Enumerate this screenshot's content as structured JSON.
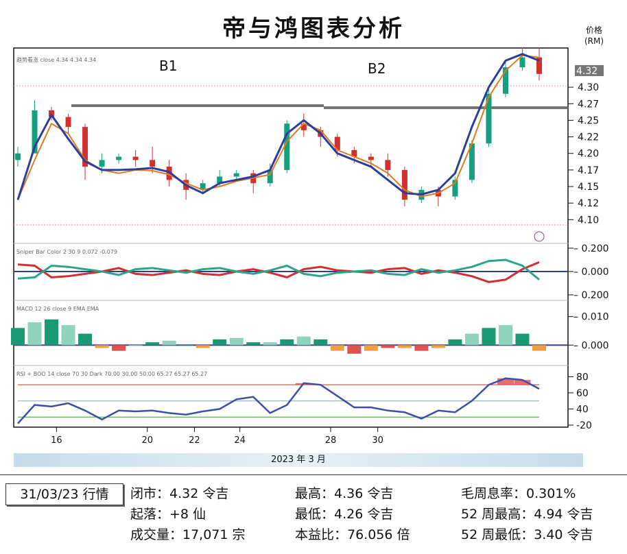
{
  "title": "帝与鸿图表分析",
  "price_unit": [
    "价格",
    "(RM)"
  ],
  "period_label": "2023 年 3 月",
  "colors": {
    "up": "#14a07e",
    "down": "#d22f2f",
    "ma_fast": "#2c3e9c",
    "ma_slow": "#e07b20",
    "resistance": "#707070"
  },
  "stats": {
    "date_label": "31/03/23 行情",
    "close": "闭市：4.32 令吉",
    "change": "起落：+8 仙",
    "volume": "成交量：17,071 宗",
    "high": "最高：4.36 令吉",
    "low": "最低：4.26 令吉",
    "pe": "本益比：76.056 倍",
    "dividend": "毛周息率：0.301%",
    "w52_high": "52 周最高：4.94 令吉",
    "w52_low": "52 周最低：3.40 令吉"
  },
  "chart_data": {
    "type": "line",
    "annotations": [
      "B1",
      "B2"
    ],
    "x_ticks": [
      "16",
      "20",
      "22",
      "24",
      "28",
      "30"
    ],
    "price_panel": {
      "legend": "趋势看涨 close 4.34 4.34 4.34",
      "y_ticks": [
        "4.30",
        "4.27",
        "4.25",
        "4.22",
        "4.20",
        "4.17",
        "4.15",
        "4.12",
        "4.10"
      ],
      "last_price": "4.32",
      "resistance_level": 4.27,
      "ylim": [
        4.09,
        4.355
      ],
      "ma_fast": [
        4.13,
        4.21,
        4.258,
        4.222,
        4.188,
        4.175,
        4.175,
        4.176,
        4.178,
        4.172,
        4.152,
        4.14,
        4.155,
        4.16,
        4.165,
        4.175,
        4.23,
        4.25,
        4.23,
        4.2,
        4.19,
        4.18,
        4.16,
        4.14,
        4.138,
        4.145,
        4.17,
        4.24,
        4.3,
        4.34,
        4.35,
        4.34
      ],
      "ma_slow": [
        4.13,
        4.19,
        4.245,
        4.23,
        4.19,
        4.175,
        4.17,
        4.175,
        4.174,
        4.168,
        4.155,
        4.145,
        4.15,
        4.158,
        4.163,
        4.168,
        4.218,
        4.245,
        4.235,
        4.205,
        4.195,
        4.185,
        4.17,
        4.145,
        4.135,
        4.14,
        4.155,
        4.215,
        4.285,
        4.325,
        4.348,
        4.345
      ],
      "candles": [
        [
          4.19,
          4.2,
          4.21,
          4.18
        ],
        [
          4.2,
          4.265,
          4.28,
          4.2
        ],
        [
          4.265,
          4.255,
          4.27,
          4.25
        ],
        [
          4.255,
          4.24,
          4.26,
          4.23
        ],
        [
          4.24,
          4.18,
          4.245,
          4.16
        ],
        [
          4.18,
          4.19,
          4.2,
          4.17
        ],
        [
          4.19,
          4.195,
          4.2,
          4.185
        ],
        [
          4.195,
          4.19,
          4.205,
          4.18
        ],
        [
          4.19,
          4.18,
          4.21,
          4.17
        ],
        [
          4.18,
          4.16,
          4.19,
          4.15
        ],
        [
          4.16,
          4.145,
          4.17,
          4.13
        ],
        [
          4.145,
          4.155,
          4.16,
          4.14
        ],
        [
          4.155,
          4.165,
          4.175,
          4.15
        ],
        [
          4.165,
          4.17,
          4.175,
          4.16
        ],
        [
          4.17,
          4.155,
          4.175,
          4.14
        ],
        [
          4.155,
          4.175,
          4.185,
          4.15
        ],
        [
          4.175,
          4.245,
          4.25,
          4.17
        ],
        [
          4.245,
          4.235,
          4.26,
          4.225
        ],
        [
          4.235,
          4.225,
          4.24,
          4.21
        ],
        [
          4.225,
          4.205,
          4.23,
          4.195
        ],
        [
          4.205,
          4.195,
          4.21,
          4.185
        ],
        [
          4.195,
          4.19,
          4.2,
          4.18
        ],
        [
          4.19,
          4.175,
          4.2,
          4.165
        ],
        [
          4.175,
          4.13,
          4.18,
          4.12
        ],
        [
          4.13,
          4.145,
          4.15,
          4.125
        ],
        [
          4.145,
          4.135,
          4.15,
          4.12
        ],
        [
          4.135,
          4.16,
          4.165,
          4.13
        ],
        [
          4.16,
          4.215,
          4.22,
          4.155
        ],
        [
          4.215,
          4.29,
          4.3,
          4.21
        ],
        [
          4.29,
          4.33,
          4.34,
          4.285
        ],
        [
          4.33,
          4.345,
          4.36,
          4.325
        ],
        [
          4.345,
          4.32,
          4.36,
          4.31
        ]
      ]
    },
    "sniper_panel": {
      "legend": "Sniper Bar Color 2 30 9 0.072 -0.079",
      "y_ticks": [
        "0.200",
        "0.000",
        "0.200"
      ],
      "ylim": [
        -0.2,
        0.2
      ],
      "green": [
        -0.06,
        -0.05,
        0.05,
        0.04,
        0.02,
        0.0,
        -0.03,
        0.02,
        0.03,
        0.01,
        -0.01,
        0.02,
        0.03,
        0.0,
        -0.02,
        0.01,
        0.05,
        -0.02,
        -0.04,
        -0.01,
        0.0,
        0.01,
        -0.02,
        -0.03,
        0.02,
        -0.01,
        0.01,
        0.04,
        0.09,
        0.1,
        0.05,
        -0.07
      ],
      "red": [
        0.06,
        0.05,
        -0.05,
        -0.04,
        -0.02,
        0.0,
        0.03,
        -0.02,
        -0.03,
        -0.01,
        0.01,
        -0.02,
        -0.03,
        0.0,
        0.02,
        -0.01,
        -0.05,
        0.02,
        0.04,
        0.01,
        0.0,
        -0.01,
        0.02,
        0.03,
        -0.02,
        0.01,
        -0.01,
        -0.04,
        -0.09,
        -0.07,
        0.02,
        0.08
      ]
    },
    "macd_panel": {
      "legend": "MACD 12 26 close 9 EMA EMA",
      "y_ticks": [
        "0.010",
        "0.000"
      ],
      "ylim": [
        -0.004,
        0.014
      ],
      "histogram": [
        0.006,
        0.008,
        0.009,
        0.007,
        0.004,
        -0.001,
        -0.002,
        0.0,
        0.001,
        0.0015,
        0.0,
        -0.001,
        0.002,
        0.0025,
        0.001,
        0.001,
        0.002,
        0.003,
        0.002,
        -0.002,
        -0.003,
        -0.002,
        -0.001,
        -0.001,
        -0.002,
        -0.001,
        0.002,
        0.004,
        0.006,
        0.007,
        0.004,
        -0.002
      ]
    },
    "rsi_panel": {
      "legend": "RSI + BOO 14 close 70 30 Dark 70.00 30.00 50.00 65.27 65.27 65.27",
      "y_ticks": [
        "80",
        "60",
        "40",
        "-20"
      ],
      "ylim": [
        20,
        88
      ],
      "levels": [
        70,
        50,
        30
      ],
      "values": [
        22,
        45,
        43,
        47,
        38,
        27,
        38,
        37,
        38,
        35,
        33,
        37,
        40,
        52,
        55,
        35,
        45,
        72,
        70,
        56,
        42,
        42,
        38,
        36,
        28,
        38,
        36,
        50,
        70,
        78,
        76,
        65
      ]
    }
  }
}
